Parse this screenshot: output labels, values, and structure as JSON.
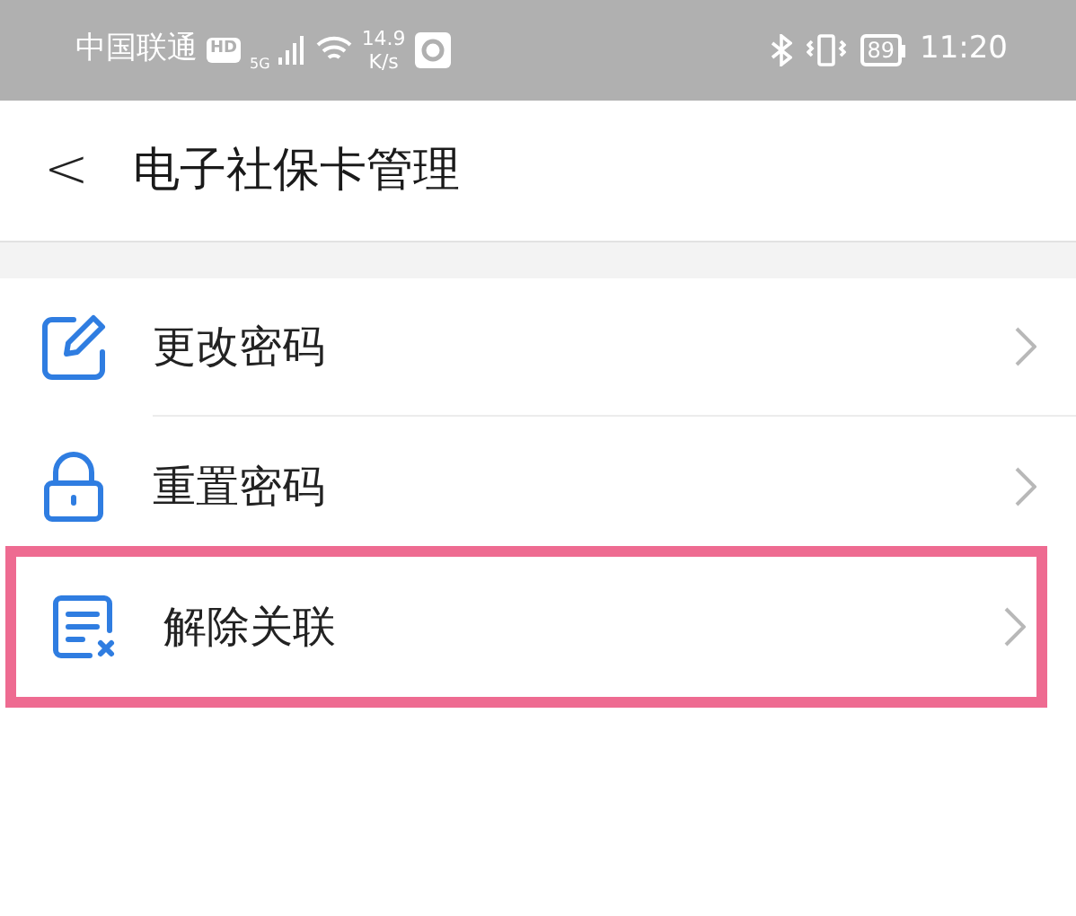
{
  "status_bar": {
    "carrier": "中国联通",
    "hd": "HD",
    "network": "5G",
    "speed_value": "14.9",
    "speed_unit": "K/s",
    "battery": "89",
    "time": "11:20"
  },
  "header": {
    "back": "<",
    "title": "电子社保卡管理"
  },
  "menu": [
    {
      "kind": "edit",
      "label": "更改密码",
      "highlighted": false
    },
    {
      "kind": "lock",
      "label": "重置密码",
      "highlighted": false
    },
    {
      "kind": "unlink",
      "label": "解除关联",
      "highlighted": true
    }
  ]
}
